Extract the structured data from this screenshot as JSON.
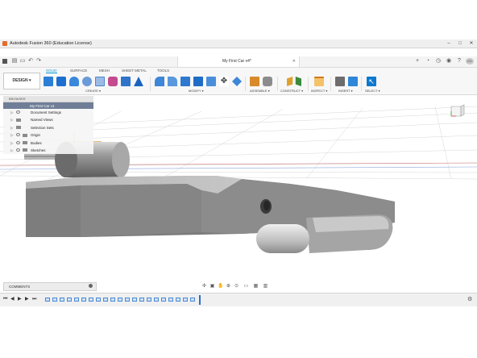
{
  "window": {
    "title": "Autodesk Fusion 360 (Education License)"
  },
  "document_tab": {
    "title": "My First Car v4*"
  },
  "workspace": {
    "label": "DESIGN"
  },
  "ribbon_tabs": [
    "SOLID",
    "SURFACE",
    "MESH",
    "SHEET METAL",
    "TOOLS"
  ],
  "groups": {
    "create": "CREATE",
    "modify": "MODIFY",
    "assemble": "ASSEMBLE",
    "construct": "CONSTRUCT",
    "inspect": "INSPECT",
    "insert": "INSERT",
    "select": "SELECT"
  },
  "browser": {
    "header": "BROWSER",
    "root": "My First Car v4",
    "items": [
      "Document Settings",
      "Named Views",
      "Selection Sets",
      "Origin",
      "Bodies",
      "Sketches"
    ]
  },
  "comments": {
    "label": "COMMENTS"
  },
  "view_cube": {
    "label": "FRONT"
  },
  "colors": {
    "accent": "#0696d7",
    "browser_root": "#6f7e96",
    "model_gray": "#8e8e8e",
    "sketch_profile": "#e6a64c"
  }
}
